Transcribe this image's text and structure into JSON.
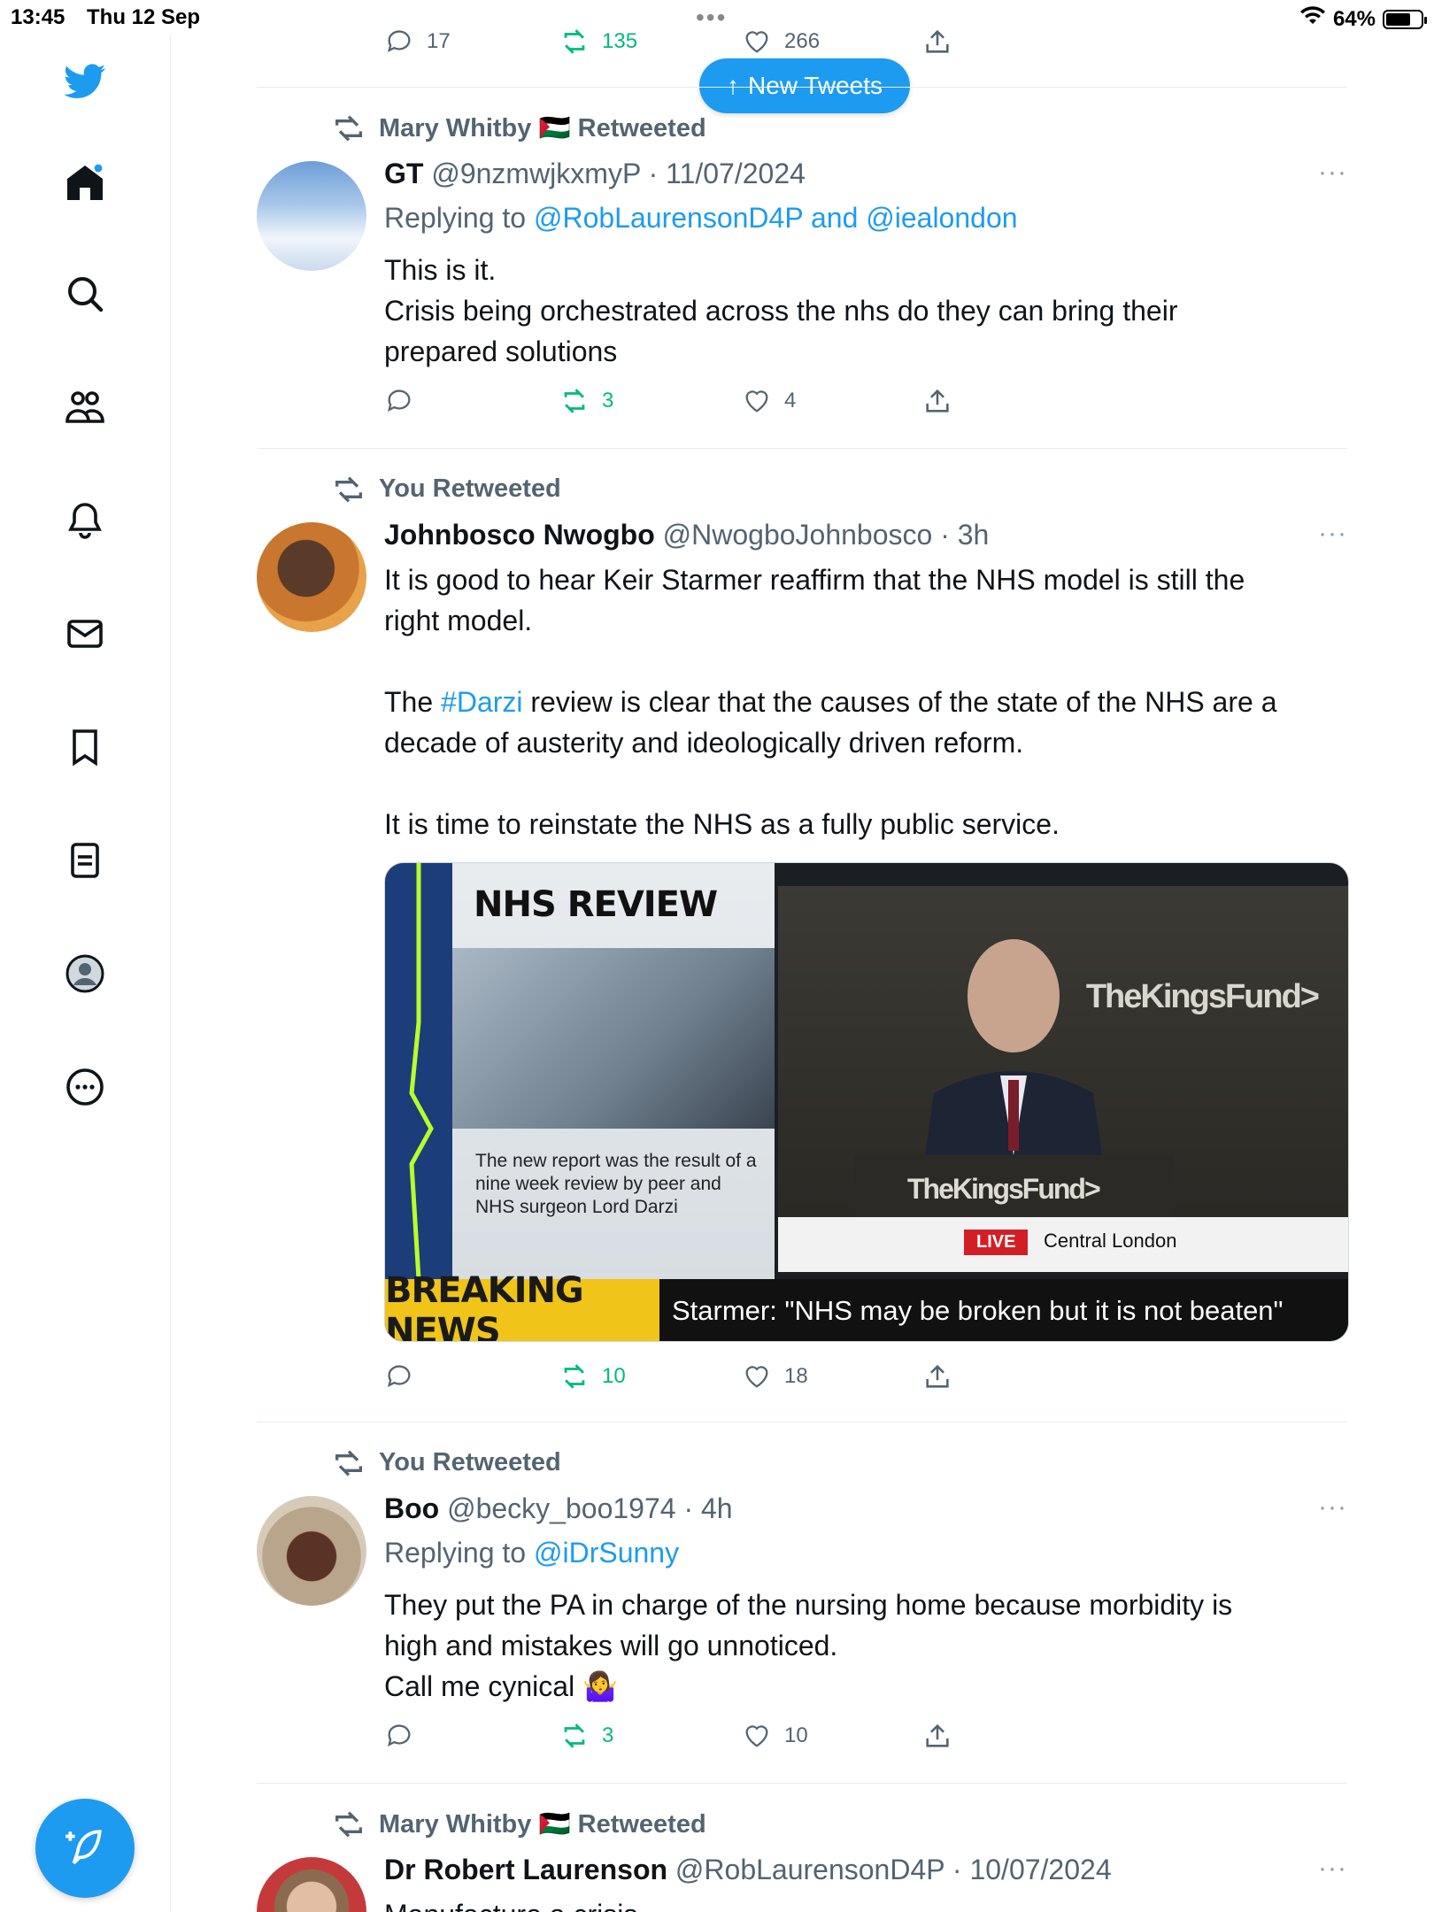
{
  "status_bar": {
    "time": "13:45",
    "date": "Thu 12 Sep",
    "dots": "•••",
    "battery": "64%",
    "battery_level": 0.64
  },
  "new_tweets_label": "New Tweets",
  "top_actions": {
    "replies": "17",
    "retweets": "135",
    "likes": "266"
  },
  "tweets": [
    {
      "retweeted_by": "Mary Whitby 🇵🇸 Retweeted",
      "name": "GT",
      "handle_time": "@9nzmwjkxmyP · 11/07/2024",
      "replying_prefix": "Replying to",
      "replying_targets": "@RobLaurensonD4P and @iealondon",
      "lines": [
        "This is it.",
        "Crisis being orchestrated across the nhs do they can bring their",
        "prepared solutions"
      ],
      "replies": "",
      "retweets": "3",
      "likes": "4"
    },
    {
      "retweeted_by": "You Retweeted",
      "name": "Johnbosco Nwogbo",
      "handle_time": "@NwogboJohnbosco · 3h",
      "p1a": "It is good to hear Keir Starmer reaffirm that the NHS model is still the",
      "p1b": "right model.",
      "p2_pre": "The ",
      "p2_tag": "#Darzi",
      "p2_post": " review is clear that the causes of the state of the NHS are a",
      "p2b": "decade of austerity and ideologically driven reform.",
      "p3": "It is time to reinstate the NHS as a fully public service.",
      "media": {
        "nhs_title": "NHS REVIEW",
        "caption": "The new report was the result of a nine week review by peer and NHS surgeon Lord Darzi",
        "kings_fund_top": "TheKingsFund>",
        "kings_fund_podium": "TheKingsFund>",
        "live_tag": "LIVE",
        "live_location": "Central London",
        "breaking": "BREAKING NEWS",
        "ticker": "Starmer: \"NHS may be broken but it is not beaten\""
      },
      "retweets": "10",
      "likes": "18"
    },
    {
      "retweeted_by": "You Retweeted",
      "name": "Boo",
      "handle_time": "@becky_boo1974 · 4h",
      "replying_prefix": "Replying to",
      "replying_targets": "@iDrSunny",
      "lines": [
        "They put the PA in charge of the nursing home because morbidity is",
        "high and mistakes will go unnoticed.",
        "Call me cynical 🤷‍♀️"
      ],
      "retweets": "3",
      "likes": "10"
    },
    {
      "retweeted_by": "Mary Whitby 🇵🇸 Retweeted",
      "name": "Dr Robert Laurenson",
      "handle_time": "@RobLaurensonD4P · 10/07/2024",
      "lines": [
        "Manufacture a crisis"
      ]
    }
  ],
  "more_label": "···",
  "colors": {
    "accent": "#1d9bf0",
    "retweet": "#00ba7c",
    "muted": "#536471"
  }
}
